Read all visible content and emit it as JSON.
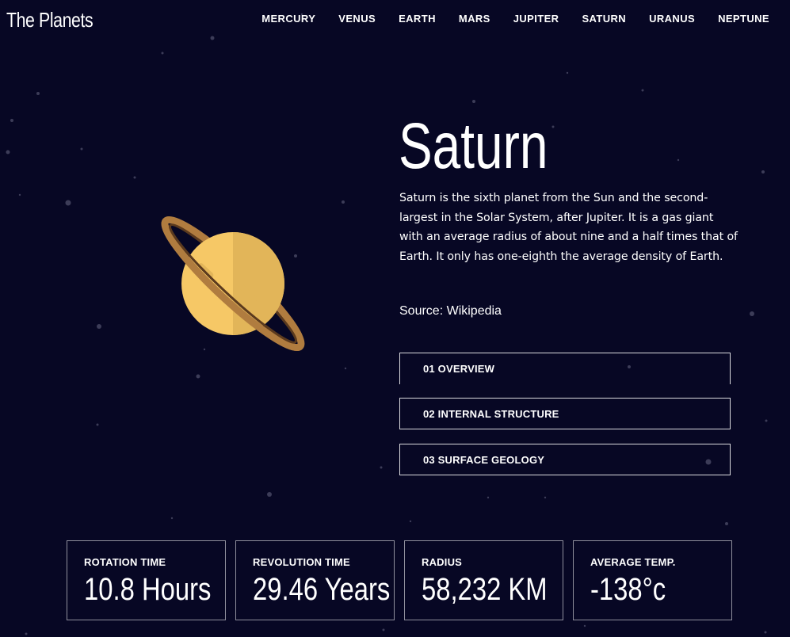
{
  "header": {
    "logo": "The Planets",
    "nav": [
      "MERCURY",
      "VENUS",
      "EARTH",
      "MARS",
      "JUPITER",
      "SATURN",
      "URANUS",
      "NEPTUNE"
    ]
  },
  "planet": {
    "name": "Saturn",
    "description": "Saturn is the sixth planet from the Sun and the second-largest in the Solar System, after Jupiter. It is a gas giant with an average radius of about nine and a half times that of Earth. It only has one-eighth the average density of Earth.",
    "source_text": "Source: Wikipedia",
    "colors": {
      "body_light": "#F6C866",
      "body_shade": "#E2B559",
      "ring": "#B07C3F",
      "ring_dark": "#5B3A1E"
    }
  },
  "tabs": [
    "01 OVERVIEW",
    "02 INTERNAL STRUCTURE",
    "03 SURFACE GEOLOGY"
  ],
  "stats": [
    {
      "label": "ROTATION TIME",
      "value": "10.8 Hours"
    },
    {
      "label": "REVOLUTION TIME",
      "value": "29.46 Years"
    },
    {
      "label": "RADIUS",
      "value": "58,232 KM"
    },
    {
      "label": "AVERAGE TEMP.",
      "value": "-138°c"
    }
  ],
  "theme": {
    "background": "#070724",
    "text": "#FFFFFF",
    "star": "#3C3C58"
  }
}
